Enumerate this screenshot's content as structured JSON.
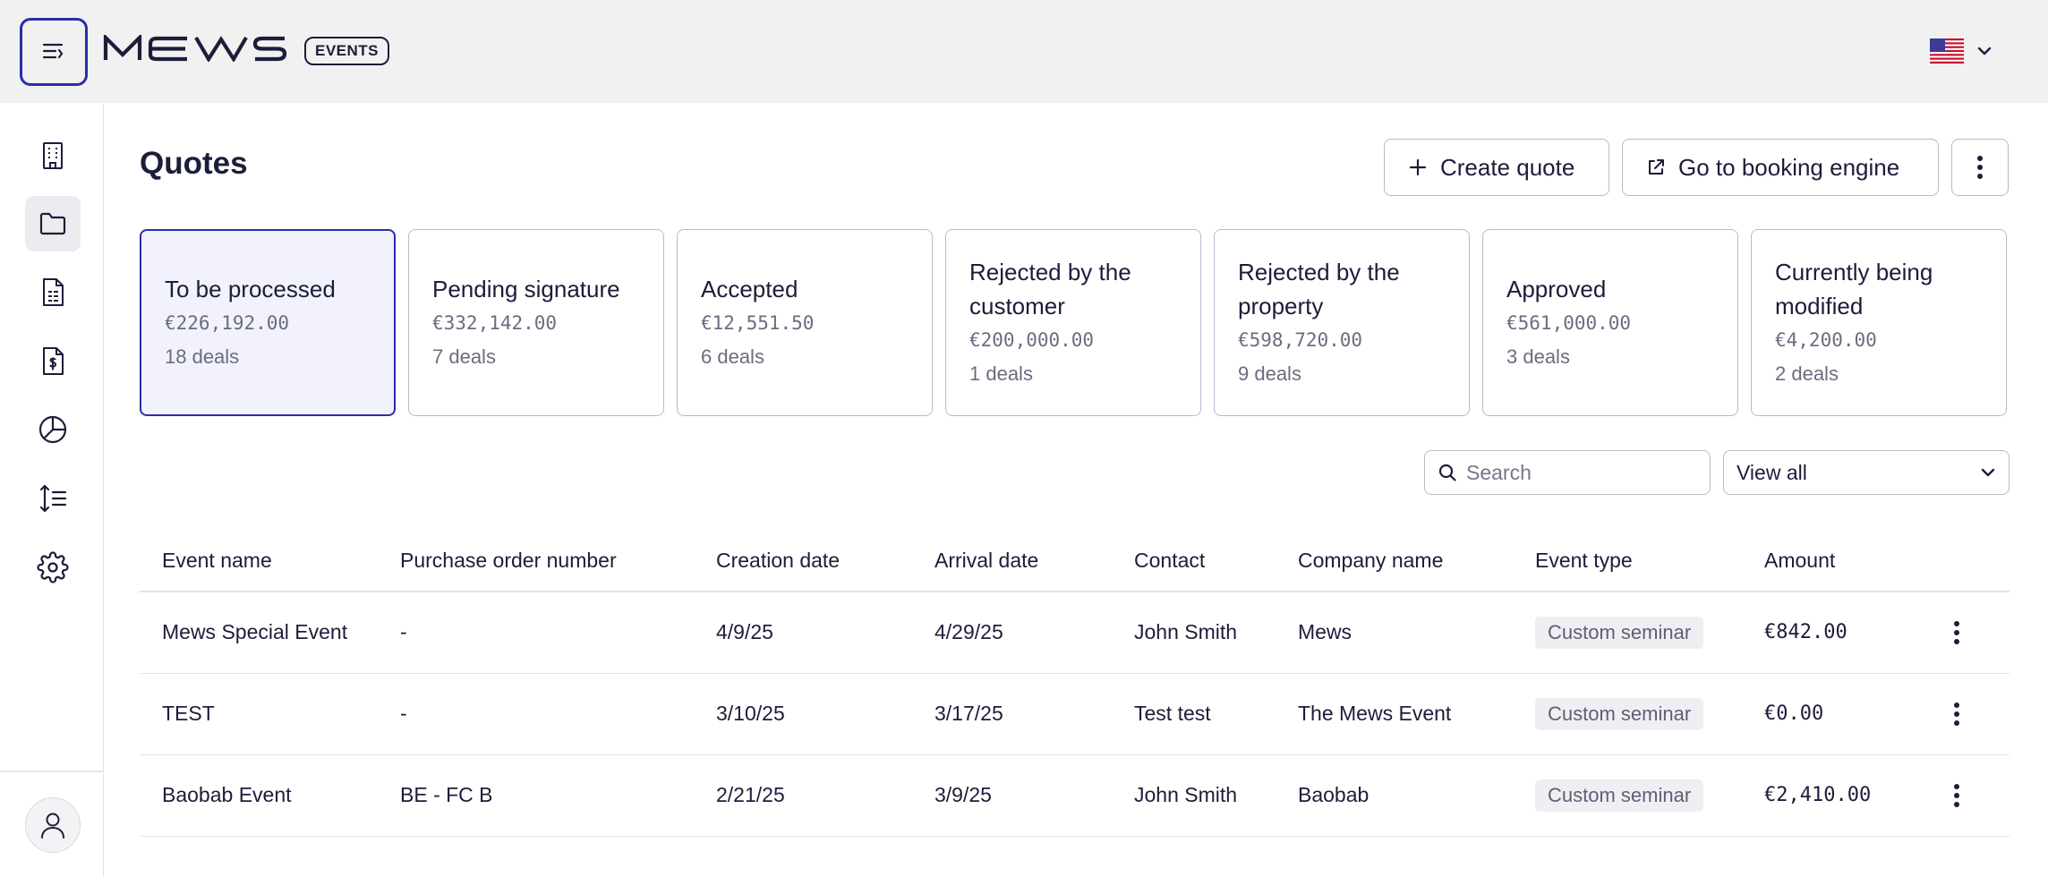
{
  "header": {
    "brand": "MEWS",
    "product_badge": "EVENTS",
    "language_flag": "us-flag-icon"
  },
  "sidebar": {
    "items": [
      {
        "name": "building-icon",
        "active": false
      },
      {
        "name": "folder-icon",
        "active": true
      },
      {
        "name": "invoice-icon",
        "active": false
      },
      {
        "name": "dollar-document-icon",
        "active": false
      },
      {
        "name": "pie-chart-icon",
        "active": false
      },
      {
        "name": "sort-lines-icon",
        "active": false
      },
      {
        "name": "gear-icon",
        "active": false
      }
    ],
    "user_icon": "user-icon"
  },
  "page": {
    "title": "Quotes",
    "actions": {
      "create_label": "Create quote",
      "booking_label": "Go to booking engine"
    }
  },
  "stats": [
    {
      "title": "To be processed",
      "amount": "€226,192.00",
      "count": "18 deals",
      "active": true
    },
    {
      "title": "Pending signature",
      "amount": "€332,142.00",
      "count": "7 deals",
      "active": false
    },
    {
      "title": "Accepted",
      "amount": "€12,551.50",
      "count": "6 deals",
      "active": false
    },
    {
      "title": "Rejected by the customer",
      "amount": "€200,000.00",
      "count": "1 deals",
      "active": false
    },
    {
      "title": "Rejected by the property",
      "amount": "€598,720.00",
      "count": "9 deals",
      "active": false
    },
    {
      "title": "Approved",
      "amount": "€561,000.00",
      "count": "3 deals",
      "active": false
    },
    {
      "title": "Currently being modified",
      "amount": "€4,200.00",
      "count": "2 deals",
      "active": false
    }
  ],
  "filters": {
    "search_placeholder": "Search",
    "view_selected": "View all"
  },
  "table": {
    "columns": [
      "Event name",
      "Purchase order number",
      "Creation date",
      "Arrival date",
      "Contact",
      "Company name",
      "Event type",
      "Amount"
    ],
    "rows": [
      [
        "Mews Special Event",
        "-",
        "4/9/25",
        "4/29/25",
        "John Smith",
        "Mews",
        "Custom seminar",
        "€842.00"
      ],
      [
        "TEST",
        "-",
        "3/10/25",
        "3/17/25",
        "Test test",
        "The Mews Event",
        "Custom seminar",
        "€0.00"
      ],
      [
        "Baobab Event",
        "BE - FC B",
        "2/21/25",
        "3/9/25",
        "John Smith",
        "Baobab",
        "Custom seminar",
        "€2,410.00"
      ]
    ]
  },
  "colors": {
    "accent": "#2b2ea8",
    "active_card_bg": "#f1f2fb",
    "topbar_bg": "#f1f1f1"
  }
}
